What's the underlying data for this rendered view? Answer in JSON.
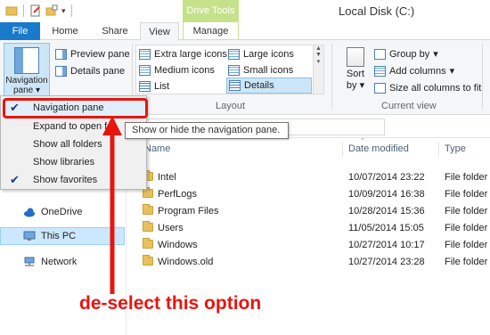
{
  "window": {
    "title": "Local Disk (C:)",
    "contextual_tab_group": "Drive Tools"
  },
  "tabs": [
    "File",
    "Home",
    "Share",
    "View",
    "Manage"
  ],
  "ribbon": {
    "panes": {
      "navigation_pane_label_1": "Navigation",
      "navigation_pane_label_2": "pane",
      "preview_pane": "Preview pane",
      "details_pane": "Details pane"
    },
    "layout": {
      "items": [
        "Extra large icons",
        "Large icons",
        "Medium icons",
        "Small icons",
        "List",
        "Details"
      ],
      "selected": "Details",
      "group_label": "Layout"
    },
    "current_view": {
      "sort_label_1": "Sort",
      "sort_label_2": "by",
      "group_by": "Group by",
      "add_columns": "Add columns",
      "size_all_columns": "Size all columns to fit",
      "group_label": "Current view"
    }
  },
  "dropdown": {
    "items": [
      {
        "label": "Navigation pane",
        "checked": true
      },
      {
        "label": "Expand to open folder",
        "checked": false
      },
      {
        "label": "Show all folders",
        "checked": false
      },
      {
        "label": "Show libraries",
        "checked": false
      },
      {
        "label": "Show favorites",
        "checked": true
      }
    ],
    "visible_labels": [
      "Navigation pane",
      "Expand to open fo",
      "Show all folders",
      "Show libraries",
      "Show favorites"
    ]
  },
  "tooltip": "Show or hide the navigation pane.",
  "navpane": {
    "items": [
      "OneDrive",
      "This PC",
      "Network"
    ],
    "selected": "This PC"
  },
  "columns": [
    "Name",
    "Date modified",
    "Type"
  ],
  "files": [
    {
      "name": "Intel",
      "date": "10/07/2014 23:22",
      "type": "File folder"
    },
    {
      "name": "PerfLogs",
      "date": "10/09/2014 16:38",
      "type": "File folder"
    },
    {
      "name": "Program Files",
      "date": "10/28/2014 15:36",
      "type": "File folder"
    },
    {
      "name": "Users",
      "date": "11/05/2014 15:05",
      "type": "File folder"
    },
    {
      "name": "Windows",
      "date": "10/27/2014 10:17",
      "type": "File folder"
    },
    {
      "name": "Windows.old",
      "date": "10/27/2014 23:28",
      "type": "File folder"
    }
  ],
  "annotation": "de-select this option",
  "colors": {
    "accent": "#1979ca",
    "highlight_red": "#e8150f",
    "drive_tools": "#c5e28a"
  }
}
